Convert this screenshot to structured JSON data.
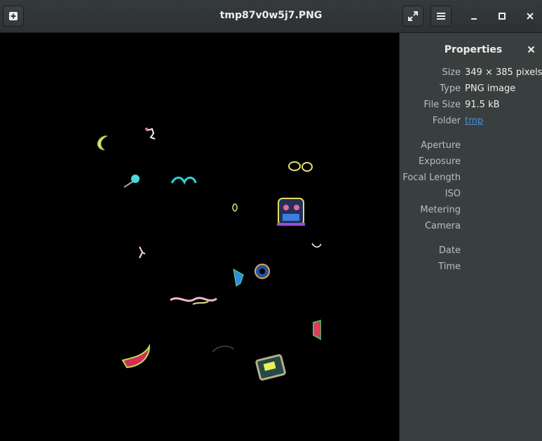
{
  "window": {
    "title": "tmp87v0w5j7.PNG"
  },
  "toolbar": {
    "add_icon": "new-window-icon",
    "fullscreen_icon": "fullscreen-icon",
    "menu_icon": "hamburger-menu-icon",
    "minimize_icon": "minimize-icon",
    "maximize_icon": "maximize-icon",
    "close_icon": "close-icon"
  },
  "sidebar": {
    "title": "Properties",
    "general": [
      {
        "key": "Size",
        "value": "349 × 385 pixels"
      },
      {
        "key": "Type",
        "value": "PNG image"
      },
      {
        "key": "File Size",
        "value": "91.5 kB"
      },
      {
        "key": "Folder",
        "value": "tmp"
      }
    ],
    "camera": [
      {
        "key": "Aperture"
      },
      {
        "key": "Exposure"
      },
      {
        "key": "Focal Length"
      },
      {
        "key": "ISO"
      },
      {
        "key": "Metering"
      },
      {
        "key": "Camera"
      }
    ],
    "datetime": [
      {
        "key": "Date"
      },
      {
        "key": "Time"
      }
    ]
  },
  "colors": {
    "titlebar": "#2f3436",
    "sidebar": "#393f3f",
    "text": "#eeeeec",
    "label": "#b9bdbd",
    "link": "#4a90d9",
    "image_bg": "#000000"
  }
}
